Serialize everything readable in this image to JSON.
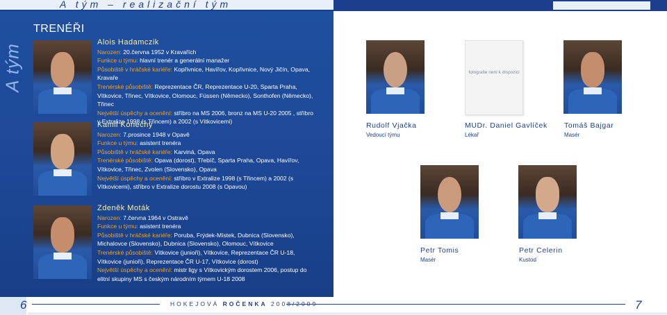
{
  "header": {
    "title": "A tým – realizační tým"
  },
  "left": {
    "side_label": "A tým",
    "section_title": "TRENÉŘI",
    "coaches": [
      {
        "name": "Alois Hadamczik",
        "born_label": "Narozen:",
        "born": "20.června 1952 v Kravařích",
        "role_label": "Funkce u týmu:",
        "role": "hlavní trenér a generální manažer",
        "player_label": "Působiště v hráčské kariéře:",
        "player": "Kopřivnice, Havířov, Kopřivnice, Nový Jičín, Opava, Kravaře",
        "coach_label": "Trenérské působiště:",
        "coach": "Reprezentace ČR, Reprezentace U-20, Sparta Praha, Vítkovice, Třinec, Vítkovice, Olomouc, Füssen (Německo), Sonthofen (Německo), Třinec",
        "success_label": "Největší úspěchy a ocenění:",
        "success": "stříbro na MS 2006, bronz na MS U-20 2005 , stříbro v Extralize 1998 (s Třincem) a 2002 (s Vítkovicemi)"
      },
      {
        "name": "Kamil Konečný",
        "born_label": "Narozen:",
        "born": "7.prosince 1948 v Opavě",
        "role_label": "Funkce u týmu:",
        "role": "asistent trenéra",
        "player_label": "Působiště v hráčské kariéře:",
        "player": "Karviná, Opava",
        "coach_label": "Trenérské působiště:",
        "coach": "Opava (dorost), Třebíč, Sparta Praha, Opava, Havířov, Vítkovice, Třinec, Zvolen (Slovensko), Opava",
        "success_label": "Největší úspěchy a ocenění:",
        "success": "stříbro v Extralize 1998 (s Třincem) a 2002 (s Vítkovicemi), stříbro v Extralize dorostu 2008 (s Opavou)"
      },
      {
        "name": "Zdeněk Moták",
        "born_label": "Narozen:",
        "born": "7.června 1964 v Ostravě",
        "role_label": "Funkce u týmu:",
        "role": "asistent trenéra",
        "player_label": "Působiště v hráčské kariéře:",
        "player": "Poruba, Frýdek-Místek, Dubnica (Slovensko), Michalovce (Slovensko), Dubnica (Slovensko), Olomouc, Vítkovice",
        "coach_label": "Trenérské působiště:",
        "coach": "Vítkovice (junioři), Vítkovice, Reprezentace ČR U-18, Vítkovice (junioři), Reprezentace ČR U-17, Vítkovice (dorost)",
        "success_label": "Největší úspěchy a ocenění:",
        "success": "mistr ligy s Vítkovickým dorostem 2006, postup do elitní skupiny MS s českým národním týmem U-18 2008"
      }
    ]
  },
  "right": {
    "not_available": "fotografie není k dispozici",
    "staff": [
      {
        "name": "Rudolf Vjačka",
        "role": "Vedoucí týmu"
      },
      {
        "name": "MUDr. Daniel Gavlíček",
        "role": "Lékař"
      },
      {
        "name": "Tomáš Bajgar",
        "role": "Masér"
      },
      {
        "name": "Petr Tomis",
        "role": "Masér"
      },
      {
        "name": "Petr Celerin",
        "role": "Kustod"
      }
    ]
  },
  "footer": {
    "page_left": "6",
    "page_right": "7",
    "pub_a": "HOKEJOVÁ",
    "pub_b": "ROČENKA",
    "pub_c": "2008/2009"
  }
}
